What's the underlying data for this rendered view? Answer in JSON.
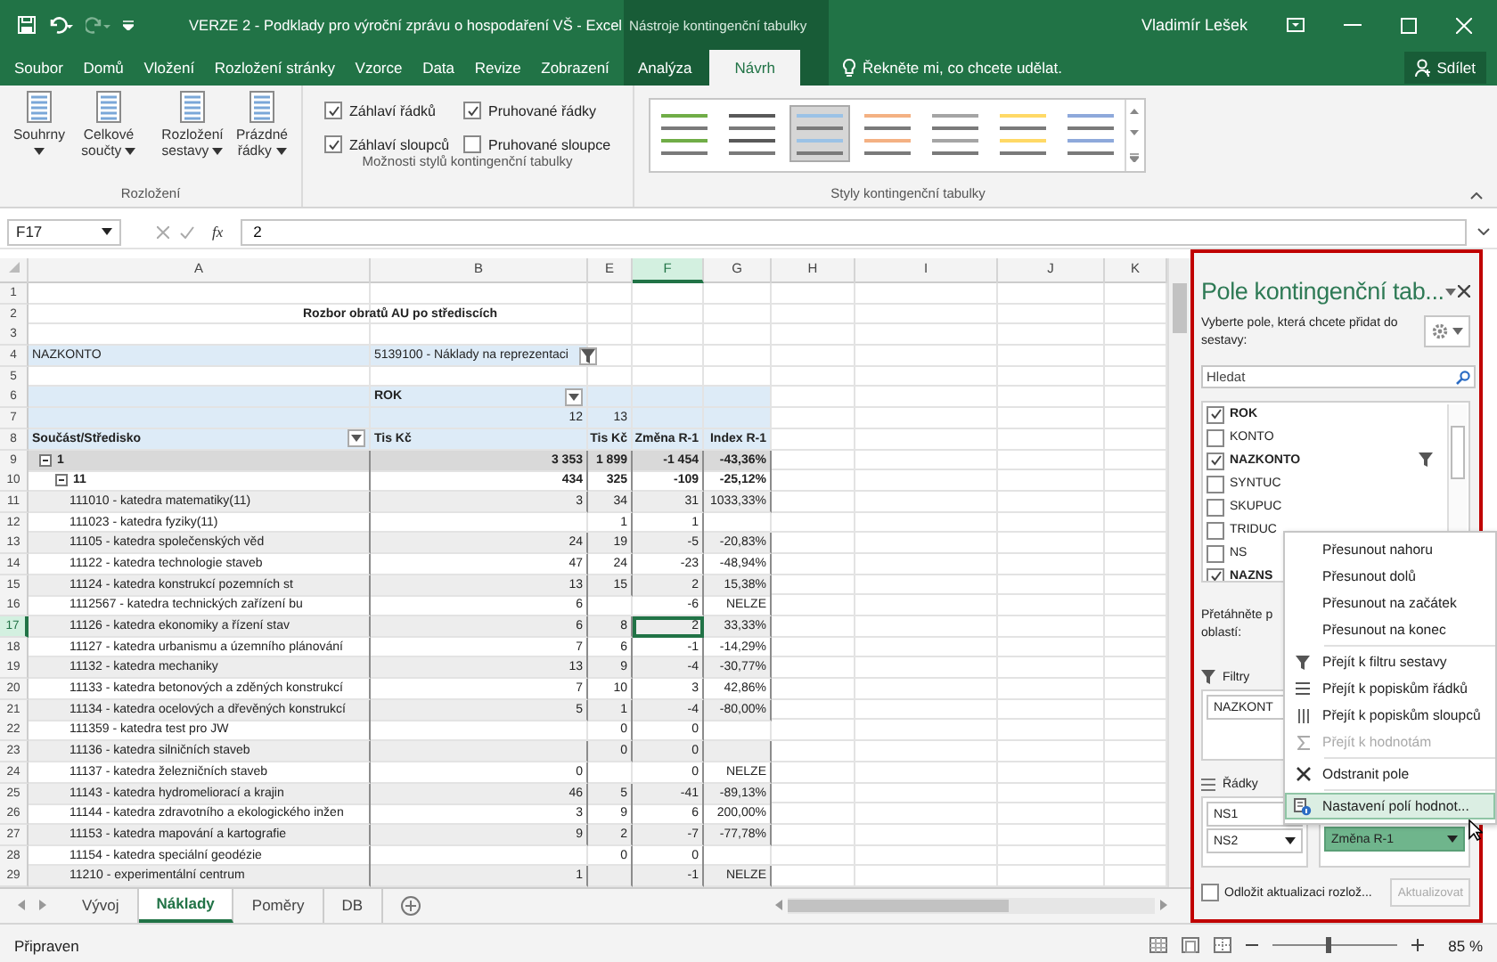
{
  "window": {
    "title": "VERZE 2 - Podklady pro výroční zprávu o hospodaření VŠ - Excel",
    "context_title": "Nástroje kontingenční tabulky",
    "user": "Vladimír Lešek"
  },
  "ribbon_tabs": [
    {
      "label": "Soubor",
      "contextual": false,
      "selected": false
    },
    {
      "label": "Domů",
      "contextual": false,
      "selected": false
    },
    {
      "label": "Vložení",
      "contextual": false,
      "selected": false
    },
    {
      "label": "Rozložení stránky",
      "contextual": false,
      "selected": false
    },
    {
      "label": "Vzorce",
      "contextual": false,
      "selected": false
    },
    {
      "label": "Data",
      "contextual": false,
      "selected": false
    },
    {
      "label": "Revize",
      "contextual": false,
      "selected": false
    },
    {
      "label": "Zobrazení",
      "contextual": false,
      "selected": false
    },
    {
      "label": "Analýza",
      "contextual": true,
      "selected": false
    },
    {
      "label": "Návrh",
      "contextual": true,
      "selected": true
    }
  ],
  "tell_me": {
    "placeholder": "Řekněte mi, co chcete udělat."
  },
  "share_button": "Sdílet",
  "ribbon": {
    "layout_group": {
      "label": "Rozložení",
      "buttons": [
        "Souhrny",
        "Celkové součty",
        "Rozložení sestavy",
        "Prázdné řádky"
      ]
    },
    "style_options": {
      "label": "Možnosti stylů kontingenční tabulky",
      "options": [
        {
          "label": "Záhlaví řádků",
          "checked": true
        },
        {
          "label": "Pruhované řádky",
          "checked": true
        },
        {
          "label": "Záhlaví sloupců",
          "checked": true
        },
        {
          "label": "Pruhované sloupce",
          "checked": false
        }
      ]
    },
    "styles": {
      "label": "Styly kontingenční tabulky",
      "swatches": [
        {
          "color": "#70ad47",
          "selected": false
        },
        {
          "color": "#595959",
          "selected": false
        },
        {
          "color": "#9bc2e6",
          "selected": true
        },
        {
          "color": "#f4b183",
          "selected": false
        },
        {
          "color": "#a5a5a5",
          "selected": false
        },
        {
          "color": "#ffd966",
          "selected": false
        },
        {
          "color": "#8ea9db",
          "selected": false
        }
      ]
    }
  },
  "formula_bar": {
    "name_box": "F17",
    "function_label": "fx",
    "value": "2"
  },
  "sheet": {
    "columns": [
      {
        "label": "A",
        "selected": false
      },
      {
        "label": "B",
        "selected": false
      },
      {
        "label": "E",
        "selected": false
      },
      {
        "label": "F",
        "selected": true
      },
      {
        "label": "G",
        "selected": false
      },
      {
        "label": "H",
        "selected": false
      },
      {
        "label": "I",
        "selected": false
      },
      {
        "label": "J",
        "selected": false
      },
      {
        "label": "K",
        "selected": false
      }
    ],
    "rows": [
      {
        "num": "1",
        "kind": "blank",
        "selected": false,
        "cells": {}
      },
      {
        "num": "2",
        "kind": "title",
        "selected": false,
        "cells": {
          "A": "Rozbor obratů AU po střediscích"
        }
      },
      {
        "num": "3",
        "kind": "blank",
        "selected": false,
        "cells": {}
      },
      {
        "num": "4",
        "kind": "report_filter",
        "selected": false,
        "cells": {
          "A": "NAZKONTO",
          "B": "5139100 - Náklady na reprezentaci"
        }
      },
      {
        "num": "5",
        "kind": "blank",
        "selected": false,
        "cells": {}
      },
      {
        "num": "6",
        "kind": "column_field",
        "selected": false,
        "cells": {
          "B": "ROK"
        }
      },
      {
        "num": "7",
        "kind": "column_items",
        "selected": false,
        "cells": {
          "B": "12",
          "E": "13"
        }
      },
      {
        "num": "8",
        "kind": "column_headers",
        "selected": false,
        "cells": {
          "A": "Součást/Středisko",
          "B": "Tis Kč",
          "E": "Tis Kč",
          "F": "Změna R-1",
          "G": "Index R-1"
        }
      },
      {
        "num": "9",
        "kind": "total",
        "selected": false,
        "shaded": true,
        "expanded": true,
        "cells": {
          "A": "1",
          "B": "3 353",
          "E": "1 899",
          "F": "-1 454",
          "G": "-43,36%"
        }
      },
      {
        "num": "10",
        "kind": "subtotal",
        "selected": false,
        "shaded": false,
        "expanded": true,
        "cells": {
          "A": "11",
          "B": "434",
          "E": "325",
          "F": "-109",
          "G": "-25,12%"
        }
      },
      {
        "num": "11",
        "kind": "item",
        "selected": false,
        "shaded": true,
        "cells": {
          "A": "111010 - katedra matematiky(11)",
          "B": "3",
          "E": "34",
          "F": "31",
          "G": "1033,33%"
        }
      },
      {
        "num": "12",
        "kind": "item",
        "selected": false,
        "shaded": false,
        "cells": {
          "A": "111023 - katedra fyziky(11)",
          "E": "1",
          "F": "1"
        }
      },
      {
        "num": "13",
        "kind": "item",
        "selected": false,
        "shaded": true,
        "cells": {
          "A": "11105 - katedra společenských věd",
          "B": "24",
          "E": "19",
          "F": "-5",
          "G": "-20,83%"
        }
      },
      {
        "num": "14",
        "kind": "item",
        "selected": false,
        "shaded": false,
        "cells": {
          "A": "11122 - katedra technologie staveb",
          "B": "47",
          "E": "24",
          "F": "-23",
          "G": "-48,94%"
        }
      },
      {
        "num": "15",
        "kind": "item",
        "selected": false,
        "shaded": true,
        "cells": {
          "A": "11124 - katedra konstrukcí pozemních st",
          "B": "13",
          "E": "15",
          "F": "2",
          "G": "15,38%"
        }
      },
      {
        "num": "16",
        "kind": "item",
        "selected": false,
        "shaded": false,
        "cells": {
          "A": "1112567 - katedra technických zařízení bu",
          "B": "6",
          "F": "-6",
          "G": "NELZE"
        }
      },
      {
        "num": "17",
        "kind": "item",
        "selected": true,
        "shaded": true,
        "cells": {
          "A": "11126 - katedra ekonomiky a řízení stav",
          "B": "6",
          "E": "8",
          "F": "2",
          "G": "33,33%"
        }
      },
      {
        "num": "18",
        "kind": "item",
        "selected": false,
        "shaded": false,
        "cells": {
          "A": "11127 - katedra urbanismu a územního plánování",
          "B": "7",
          "E": "6",
          "F": "-1",
          "G": "-14,29%"
        }
      },
      {
        "num": "19",
        "kind": "item",
        "selected": false,
        "shaded": true,
        "cells": {
          "A": "11132 - katedra mechaniky",
          "B": "13",
          "E": "9",
          "F": "-4",
          "G": "-30,77%"
        }
      },
      {
        "num": "20",
        "kind": "item",
        "selected": false,
        "shaded": false,
        "cells": {
          "A": "11133 - katedra betonových a zděných konstrukcí",
          "B": "7",
          "E": "10",
          "F": "3",
          "G": "42,86%"
        }
      },
      {
        "num": "21",
        "kind": "item",
        "selected": false,
        "shaded": true,
        "cells": {
          "A": "11134 - katedra ocelových a dřevěných konstrukcí",
          "B": "5",
          "E": "1",
          "F": "-4",
          "G": "-80,00%"
        }
      },
      {
        "num": "22",
        "kind": "item",
        "selected": false,
        "shaded": false,
        "cells": {
          "A": "111359 - katedra test pro JW",
          "E": "0",
          "F": "0"
        }
      },
      {
        "num": "23",
        "kind": "item",
        "selected": false,
        "shaded": true,
        "cells": {
          "A": "11136 - katedra silničních staveb",
          "E": "0",
          "F": "0"
        }
      },
      {
        "num": "24",
        "kind": "item",
        "selected": false,
        "shaded": false,
        "cells": {
          "A": "11137 - katedra železničních staveb",
          "B": "0",
          "F": "0",
          "G": "NELZE"
        }
      },
      {
        "num": "25",
        "kind": "item",
        "selected": false,
        "shaded": true,
        "cells": {
          "A": "11143 - katedra hydromeliorací a krajin",
          "B": "46",
          "E": "5",
          "F": "-41",
          "G": "-89,13%"
        }
      },
      {
        "num": "26",
        "kind": "item",
        "selected": false,
        "shaded": false,
        "cells": {
          "A": "11144 - katedra zdravotního a ekologického inžen",
          "B": "3",
          "E": "9",
          "F": "6",
          "G": "200,00%"
        }
      },
      {
        "num": "27",
        "kind": "item",
        "selected": false,
        "shaded": true,
        "cells": {
          "A": "11153 - katedra mapování a kartografie",
          "B": "9",
          "E": "2",
          "F": "-7",
          "G": "-77,78%"
        }
      },
      {
        "num": "28",
        "kind": "item",
        "selected": false,
        "shaded": false,
        "cells": {
          "A": "11154 - katedra speciální geodézie",
          "E": "0",
          "F": "0"
        }
      },
      {
        "num": "29",
        "kind": "item",
        "selected": false,
        "shaded": true,
        "cells": {
          "A": "11210 - experimentální centrum",
          "B": "1",
          "F": "-1",
          "G": "NELZE"
        }
      }
    ]
  },
  "sheet_tabs": [
    {
      "label": "Vývoj",
      "selected": false
    },
    {
      "label": "Náklady",
      "selected": true
    },
    {
      "label": "Poměry",
      "selected": false
    },
    {
      "label": "DB",
      "selected": false
    }
  ],
  "pivot_panel": {
    "title": "Pole kontingenční tab...",
    "description": "Vyberte pole, která chcete přidat do sestavy:",
    "search": {
      "placeholder": "Hledat"
    },
    "fields": [
      {
        "label": "ROK",
        "checked": true,
        "filtered": false
      },
      {
        "label": "KONTO",
        "checked": false,
        "filtered": false
      },
      {
        "label": "NAZKONTO",
        "checked": true,
        "filtered": true
      },
      {
        "label": "SYNTUC",
        "checked": false,
        "filtered": false
      },
      {
        "label": "SKUPUC",
        "checked": false,
        "filtered": false
      },
      {
        "label": "TRIDUC",
        "checked": false,
        "filtered": false
      },
      {
        "label": "NS",
        "checked": false,
        "filtered": false
      },
      {
        "label": "NAZNS",
        "checked": true,
        "filtered": false
      }
    ],
    "drag_hint": [
      "Přetáhněte p",
      "oblastí:"
    ],
    "filters_label": "Filtry",
    "filters": [
      "NAZKONT"
    ],
    "rows_label": "Řádky",
    "rows": [
      "NS1",
      "NS2"
    ],
    "values": [
      "Změna R-1"
    ],
    "defer": {
      "label": "Odložit aktualizaci rozlož...",
      "checked": false
    },
    "update_button": {
      "label": "Aktualizovat",
      "disabled": true
    }
  },
  "context_menu": {
    "sections": [
      [
        {
          "label": "Přesunout nahoru",
          "kind": "move",
          "disabled": false,
          "selected": false
        },
        {
          "label": "Přesunout dolů",
          "kind": "move",
          "disabled": false,
          "selected": false
        },
        {
          "label": "Přesunout na začátek",
          "kind": "move",
          "disabled": false,
          "selected": false
        },
        {
          "label": "Přesunout na konec",
          "kind": "move",
          "disabled": false,
          "selected": false
        }
      ],
      [
        {
          "label": "Přejít k filtru sestavy",
          "kind": "filter",
          "disabled": false,
          "selected": false
        },
        {
          "label": "Přejít k popiskům řádků",
          "kind": "rows",
          "disabled": false,
          "selected": false
        },
        {
          "label": "Přejít k popiskům sloupců",
          "kind": "columns",
          "disabled": false,
          "selected": false
        },
        {
          "label": "Přejít k hodnotám",
          "kind": "values",
          "disabled": true,
          "selected": false
        }
      ],
      [
        {
          "label": "Odstranit pole",
          "kind": "remove",
          "disabled": false,
          "selected": false
        }
      ],
      [
        {
          "label": "Nastavení polí hodnot...",
          "kind": "settings",
          "disabled": false,
          "selected": true
        }
      ]
    ]
  },
  "status_bar": {
    "text": "Připraven",
    "zoom": {
      "level": 0.45,
      "label": "85 %"
    }
  }
}
